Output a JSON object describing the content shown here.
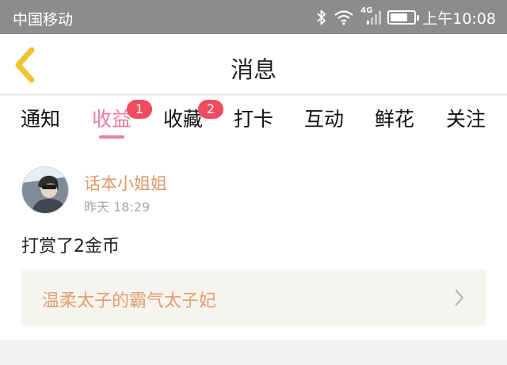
{
  "status_bar": {
    "carrier": "中国移动",
    "network_label": "4G",
    "battery_level": 0.75,
    "time": "上午10:08",
    "icons": [
      "bluetooth-icon",
      "wifi-icon",
      "signal-icon",
      "battery-icon"
    ]
  },
  "nav": {
    "title": "消息",
    "back_icon": "chevron-left-icon",
    "accent": "#f1c232"
  },
  "tabs": [
    {
      "label": "通知",
      "active": false,
      "badge": ""
    },
    {
      "label": "收益",
      "active": true,
      "badge": "1"
    },
    {
      "label": "收藏",
      "active": false,
      "badge": "2"
    },
    {
      "label": "打卡",
      "active": false,
      "badge": ""
    },
    {
      "label": "互动",
      "active": false,
      "badge": ""
    },
    {
      "label": "鲜花",
      "active": false,
      "badge": ""
    },
    {
      "label": "关注",
      "active": false,
      "badge": ""
    }
  ],
  "colors": {
    "active_tab": "#e87ea5",
    "badge": "#f24a5f",
    "username": "#e09868",
    "book_title": "#e2a072"
  },
  "notification": {
    "user_name": "话本小姐姐",
    "timestamp": "昨天 18:29",
    "message": "打赏了2金币",
    "book_title": "温柔太子的霸气太子妃",
    "arrow_icon": "chevron-right-icon"
  }
}
